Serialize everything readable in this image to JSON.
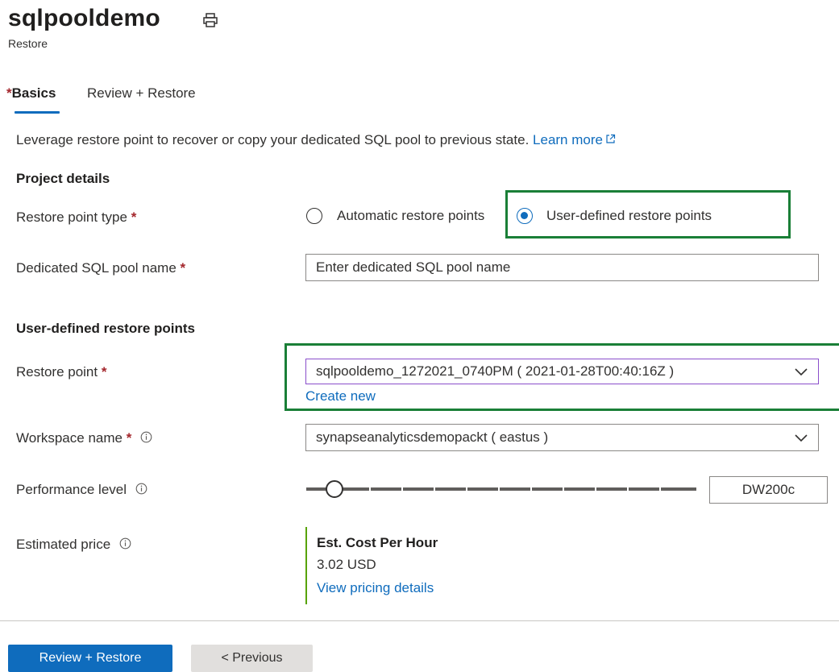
{
  "header": {
    "title": "sqlpooldemo",
    "subtitle": "Restore"
  },
  "tabs": [
    {
      "label": "Basics",
      "required_marker": "*",
      "selected": true
    },
    {
      "label": "Review + Restore",
      "selected": false
    }
  ],
  "intro": {
    "text": "Leverage restore point to recover or copy your dedicated SQL pool to previous state.",
    "link": "Learn more"
  },
  "project_details": {
    "heading": "Project details",
    "restore_point_type": {
      "label": "Restore point type",
      "required_marker": "*",
      "options": [
        "Automatic restore points",
        "User-defined restore points"
      ],
      "selected": "User-defined restore points"
    },
    "pool_name": {
      "label": "Dedicated SQL pool name",
      "required_marker": "*",
      "placeholder": "Enter dedicated SQL pool name",
      "value": ""
    }
  },
  "user_defined": {
    "heading": "User-defined restore points",
    "restore_point": {
      "label": "Restore point",
      "required_marker": "*",
      "value": "sqlpooldemo_1272021_0740PM ( 2021-01-28T00:40:16Z )",
      "create_link": "Create new"
    },
    "workspace": {
      "label": "Workspace name",
      "required_marker": "*",
      "value": "synapseanalyticsdemopackt ( eastus )"
    },
    "performance": {
      "label": "Performance level",
      "value": "DW200c",
      "slider_fraction": 0.05
    },
    "price": {
      "label": "Estimated price",
      "heading": "Est. Cost Per Hour",
      "value": "3.02 USD",
      "link": "View pricing details"
    }
  },
  "footer": {
    "primary_button": "Review + Restore",
    "secondary_button": "< Previous"
  },
  "colors": {
    "accent": "#0f6cbd",
    "highlight": "#1a7f37",
    "required": "#a4262c",
    "price_bar": "#57a300"
  }
}
